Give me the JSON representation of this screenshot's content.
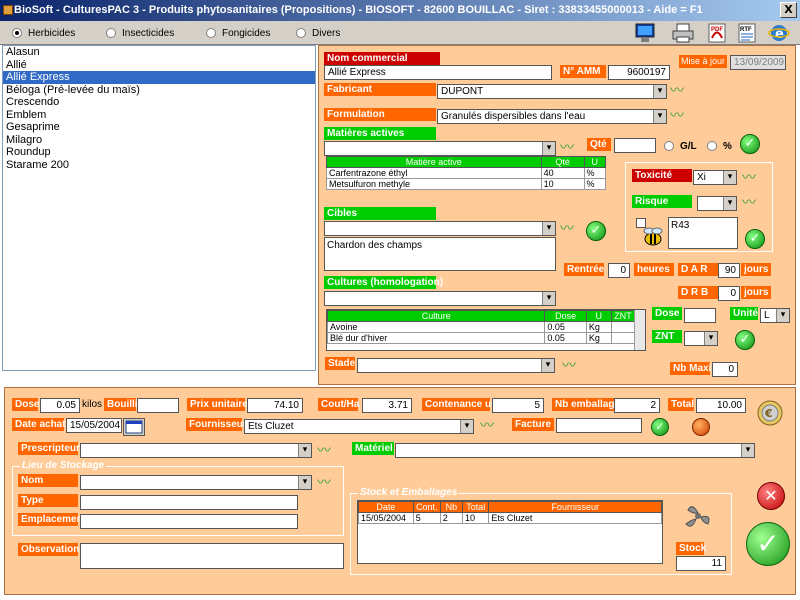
{
  "window": {
    "title": "BioSoft - CulturesPAC 3 - Produits phytosanitaires (Propositions)     - BIOSOFT - 82600 BOUILLAC - Siret : 33833455000013 - Aide = F1",
    "close": "X"
  },
  "categories": [
    {
      "label": "Herbicides",
      "selected": true
    },
    {
      "label": "Insecticides",
      "selected": false
    },
    {
      "label": "Fongicides",
      "selected": false
    },
    {
      "label": "Divers",
      "selected": false
    }
  ],
  "toolbar_icons": [
    "computer-icon",
    "printer-icon",
    "pdf-icon",
    "rtf-icon",
    "internet-explorer-icon"
  ],
  "toolbar_labels": {
    "pdf": "PDF",
    "rtf": "RTF"
  },
  "products": [
    "Alasun",
    "Allié",
    "Allié Express",
    "Béloga (Pré-levée du maïs)",
    "Crescendo",
    "Emblem",
    "Gesaprime",
    "Milagro",
    "Roundup",
    "Starame 200"
  ],
  "selected_product_index": 2,
  "detail": {
    "nom_commercial_label": "Nom commercial",
    "nom_commercial": "Allié Express",
    "amm_label": "N° AMM",
    "amm": "9600197",
    "maj_label": "Mise à jour",
    "maj": "13/09/2009",
    "fabricant_label": "Fabricant",
    "fabricant": "DUPONT",
    "formulation_label": "Formulation",
    "formulation": "Granulés dispersibles dans l'eau",
    "matieres_label": "Matières actives",
    "qte_label": "Qté",
    "gl_label": "G/L",
    "pct_label": "%",
    "matieres_headers": [
      "Matière active",
      "Qté",
      "U"
    ],
    "matieres_rows": [
      [
        "Carfentrazone éthyl",
        "40",
        "%"
      ],
      [
        "Metsulfuron methyle",
        "10",
        "%"
      ]
    ],
    "toxicite_label": "Toxicité",
    "toxicite": "Xi",
    "risque_label": "Risque",
    "risque_text": "R43",
    "cibles_label": "Cibles",
    "cibles_text": "Chardon des champs",
    "rentree_label": "Rentrée",
    "rentree": "0",
    "heures_label": "heures",
    "dar_label": "D A R",
    "dar": "90",
    "drb_label": "D R B",
    "drb": "0",
    "jours_label": "jours",
    "cultures_label": "Cultures (homologation)",
    "cultures_headers": [
      "Culture",
      "Dose",
      "U",
      "ZNT"
    ],
    "cultures_rows": [
      [
        "Avoine",
        "0.05",
        "Kg",
        ""
      ],
      [
        "Blé dur d'hiver",
        "0.05",
        "Kg",
        ""
      ]
    ],
    "dose_label": "Dose",
    "unite_label": "Unité",
    "unite": "L",
    "znt_label": "ZNT",
    "stade_label": "Stade",
    "nbmaxi_label": "Nb Maxi",
    "nbmaxi": "0"
  },
  "bottom": {
    "dose_label": "Dose",
    "dose": "0.05",
    "kilos_label": "kilos",
    "bouillie_label": "Bouillie",
    "bouillie": "",
    "prix_label": "Prix unitaire HT",
    "prix": "74.10",
    "cout_label": "Cout/Ha",
    "cout": "3.71",
    "contenance_label": "Contenance unit.",
    "contenance": "5",
    "nbemb_label": "Nb emballages",
    "nbemb": "2",
    "total_label": "Total",
    "total": "10.00",
    "date_label": "Date achat",
    "date": "15/05/2004",
    "fournisseur_label": "Fournisseur",
    "fournisseur": "Ets Cluzet",
    "facture_label": "Facture",
    "prescripteur_label": "Prescripteur",
    "materiel_label": "Matériel",
    "lieu_title": "Lieu de Stockage",
    "nom_label": "Nom",
    "type_label": "Type",
    "emplacement_label": "Emplacement",
    "observation_label": "Observation",
    "stock_title": "Stock et Emballages",
    "stock_headers": [
      "Date",
      "Cont.",
      "Nb",
      "Total",
      "Fournisseur"
    ],
    "stock_rows": [
      [
        "15/05/2004",
        "5",
        "2",
        "10",
        "Ets Cluzet"
      ]
    ],
    "stock_label": "Stock",
    "stock": "11"
  }
}
